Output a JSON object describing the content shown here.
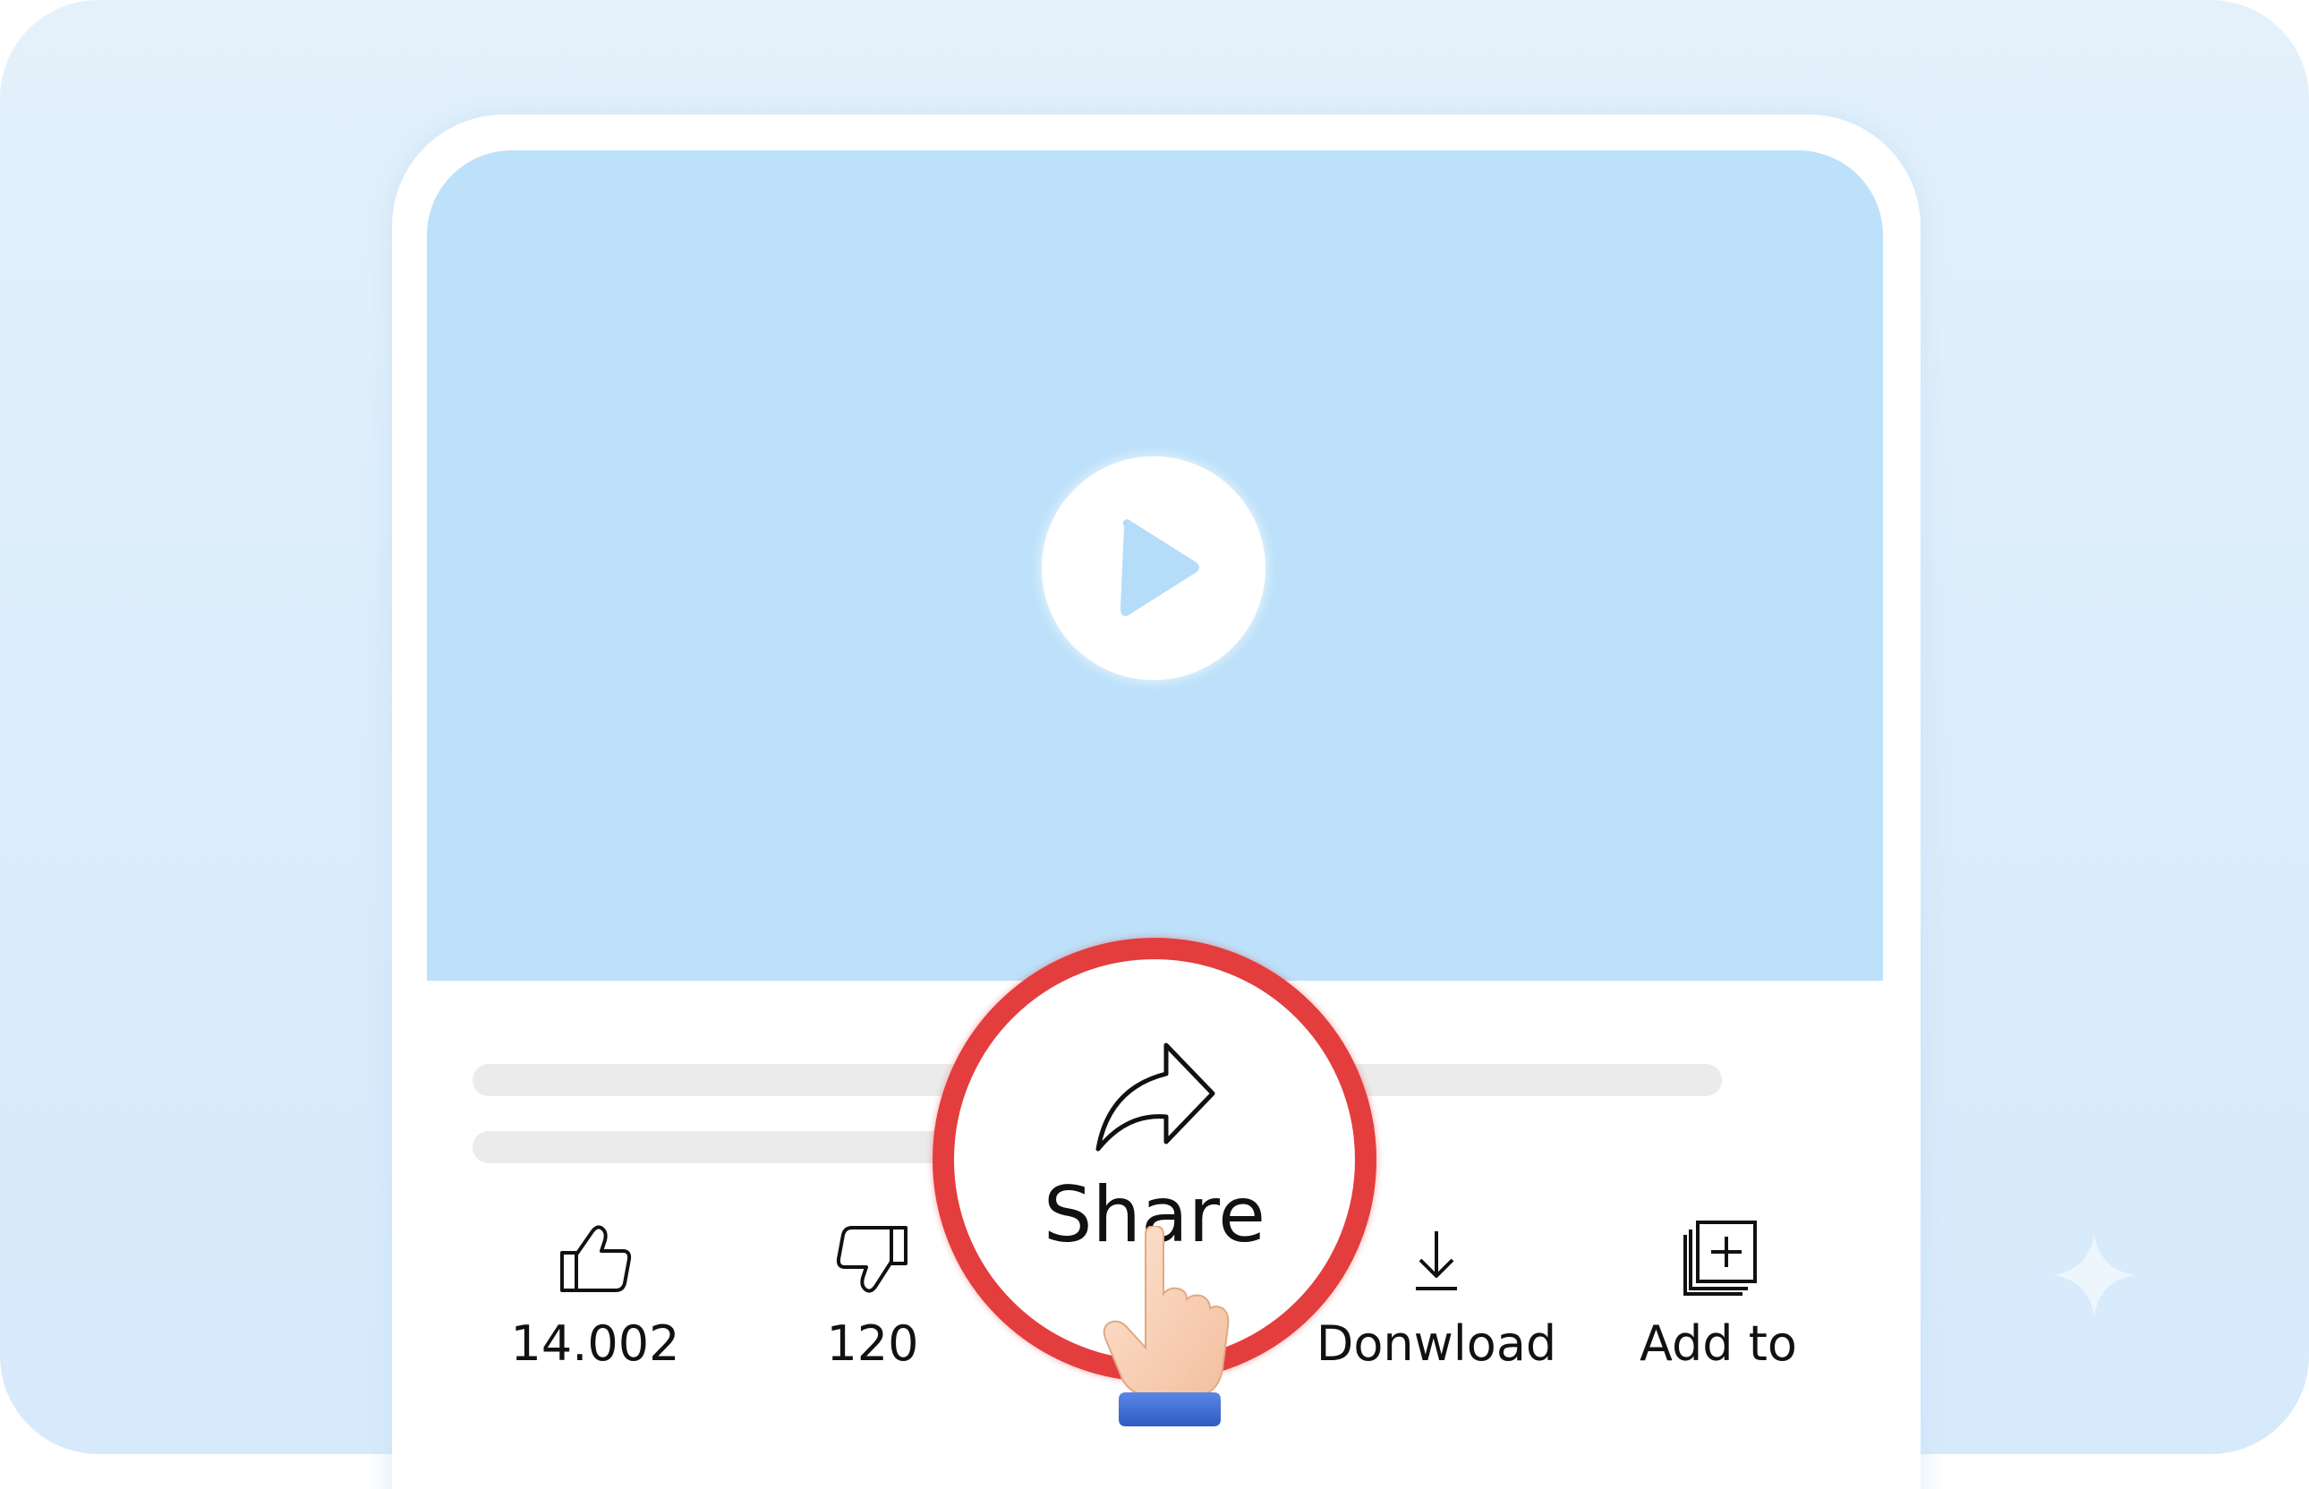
{
  "video": {
    "play_icon": "play-icon"
  },
  "actions": {
    "like": {
      "count": "14.002",
      "icon": "thumbs-up-icon"
    },
    "dislike": {
      "count": "120",
      "icon": "thumbs-down-icon"
    },
    "share": {
      "label": "Share",
      "icon": "share-arrow-icon"
    },
    "download": {
      "label": "Donwload",
      "icon": "download-icon"
    },
    "add_to": {
      "label": "Add to",
      "icon": "add-to-playlist-icon"
    }
  },
  "overlay": {
    "highlight_color": "#e43d3d",
    "pointer_icon": "pointing-hand-icon"
  },
  "colors": {
    "background": "#dcedfb",
    "video_placeholder": "#bde1fa",
    "placeholder_lines": "#ebebeb"
  }
}
